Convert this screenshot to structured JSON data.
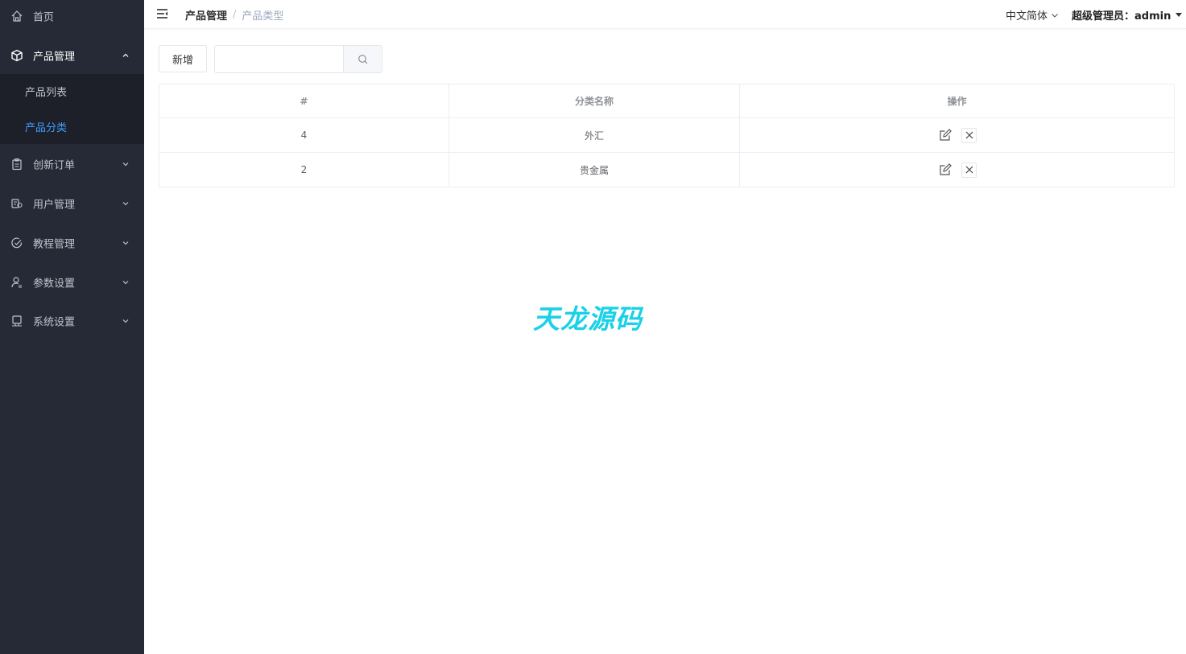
{
  "sidebar": {
    "items": [
      {
        "label": "首页",
        "icon": "home-icon"
      },
      {
        "label": "产品管理",
        "icon": "cube-icon",
        "expanded": true,
        "children": [
          {
            "label": "产品列表"
          },
          {
            "label": "产品分类",
            "active": true
          }
        ]
      },
      {
        "label": "创新订单",
        "icon": "clipboard-icon"
      },
      {
        "label": "用户管理",
        "icon": "users-icon"
      },
      {
        "label": "教程管理",
        "icon": "check-circle-icon"
      },
      {
        "label": "参数设置",
        "icon": "user-settings-icon"
      },
      {
        "label": "系统设置",
        "icon": "monitor-icon"
      }
    ]
  },
  "header": {
    "breadcrumb": [
      "产品管理",
      "产品类型"
    ],
    "breadcrumb_sep": "/",
    "language": "中文简体",
    "user": "超级管理员：admin"
  },
  "toolbar": {
    "add_label": "新增",
    "search_value": "",
    "search_placeholder": ""
  },
  "table": {
    "headers": [
      "#",
      "分类名称",
      "操作"
    ],
    "rows": [
      {
        "id": "4",
        "name": "外汇"
      },
      {
        "id": "2",
        "name": "贵金属"
      }
    ]
  },
  "watermark": "天龙源码",
  "colors": {
    "sidebar_bg": "#262a36",
    "submenu_bg": "#1d2029",
    "active_link": "#409eff",
    "watermark": "#1ad1e8"
  }
}
